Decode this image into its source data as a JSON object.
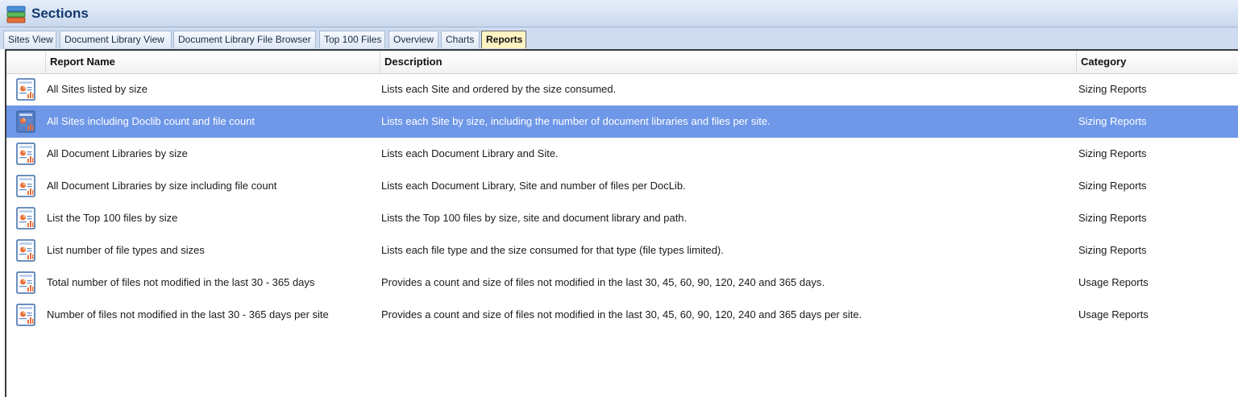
{
  "window": {
    "title": "Sections",
    "title_icon": "sections-stack-icon"
  },
  "tabs": [
    {
      "label": "Sites View",
      "active": false
    },
    {
      "label": "Document Library View",
      "active": false
    },
    {
      "label": "Document Library File Browser",
      "active": false
    },
    {
      "label": "Top 100 Files",
      "active": false
    },
    {
      "label": "Overview",
      "active": false
    },
    {
      "label": "Charts",
      "active": false
    },
    {
      "label": "Reports",
      "active": true
    }
  ],
  "grid": {
    "columns": {
      "name": "Report Name",
      "description": "Description",
      "category": "Category"
    },
    "row_icon": "report-icon",
    "selection_color": "#6e97e8",
    "rows": [
      {
        "name": "All Sites listed by size",
        "description": "Lists each Site and ordered by the size consumed.",
        "category": "Sizing Reports",
        "selected": false
      },
      {
        "name": "All Sites including Doclib count and file count",
        "description": "Lists each Site by size, including the number of document libraries and files per site.",
        "category": "Sizing Reports",
        "selected": true
      },
      {
        "name": "All Document Libraries by size",
        "description": "Lists each Document Library and Site.",
        "category": "Sizing Reports",
        "selected": false
      },
      {
        "name": "All Document Libraries by size including file count",
        "description": "Lists each Document Library, Site and number of files per DocLib.",
        "category": "Sizing Reports",
        "selected": false
      },
      {
        "name": "List the Top 100 files by size",
        "description": "Lists the Top 100 files by size, site and document library and path.",
        "category": "Sizing Reports",
        "selected": false
      },
      {
        "name": "List number of file types and sizes",
        "description": "Lists each file type and the size consumed for that type (file types limited).",
        "category": "Sizing Reports",
        "selected": false
      },
      {
        "name": "Total number of files not modified in the last 30 - 365 days",
        "description": "Provides a count and size of files not modified in the last 30, 45, 60, 90, 120, 240 and 365 days.",
        "category": "Usage Reports",
        "selected": false
      },
      {
        "name": "Number of files not modified in the last 30 - 365 days per site",
        "description": "Provides a count and size of files not modified in the last 30, 45, 60, 90, 120, 240 and 365 days per site.",
        "category": "Usage Reports",
        "selected": false
      }
    ]
  }
}
